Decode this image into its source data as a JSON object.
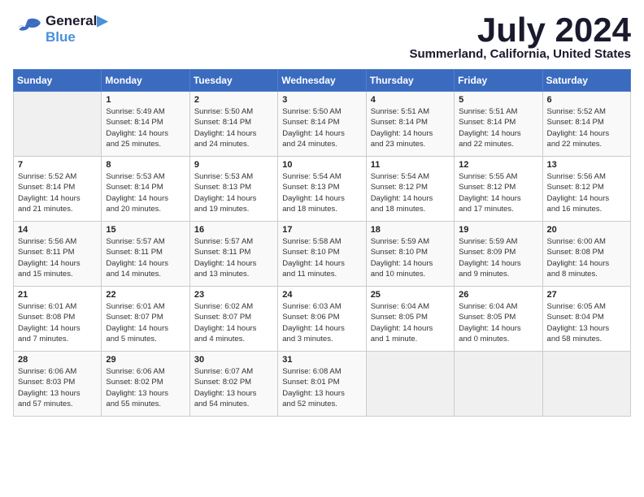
{
  "header": {
    "logo_line1": "General",
    "logo_line2": "Blue",
    "month": "July 2024",
    "location": "Summerland, California, United States"
  },
  "days_of_week": [
    "Sunday",
    "Monday",
    "Tuesday",
    "Wednesday",
    "Thursday",
    "Friday",
    "Saturday"
  ],
  "weeks": [
    [
      {
        "day": "",
        "info": ""
      },
      {
        "day": "1",
        "info": "Sunrise: 5:49 AM\nSunset: 8:14 PM\nDaylight: 14 hours\nand 25 minutes."
      },
      {
        "day": "2",
        "info": "Sunrise: 5:50 AM\nSunset: 8:14 PM\nDaylight: 14 hours\nand 24 minutes."
      },
      {
        "day": "3",
        "info": "Sunrise: 5:50 AM\nSunset: 8:14 PM\nDaylight: 14 hours\nand 24 minutes."
      },
      {
        "day": "4",
        "info": "Sunrise: 5:51 AM\nSunset: 8:14 PM\nDaylight: 14 hours\nand 23 minutes."
      },
      {
        "day": "5",
        "info": "Sunrise: 5:51 AM\nSunset: 8:14 PM\nDaylight: 14 hours\nand 22 minutes."
      },
      {
        "day": "6",
        "info": "Sunrise: 5:52 AM\nSunset: 8:14 PM\nDaylight: 14 hours\nand 22 minutes."
      }
    ],
    [
      {
        "day": "7",
        "info": "Sunrise: 5:52 AM\nSunset: 8:14 PM\nDaylight: 14 hours\nand 21 minutes."
      },
      {
        "day": "8",
        "info": "Sunrise: 5:53 AM\nSunset: 8:14 PM\nDaylight: 14 hours\nand 20 minutes."
      },
      {
        "day": "9",
        "info": "Sunrise: 5:53 AM\nSunset: 8:13 PM\nDaylight: 14 hours\nand 19 minutes."
      },
      {
        "day": "10",
        "info": "Sunrise: 5:54 AM\nSunset: 8:13 PM\nDaylight: 14 hours\nand 18 minutes."
      },
      {
        "day": "11",
        "info": "Sunrise: 5:54 AM\nSunset: 8:12 PM\nDaylight: 14 hours\nand 18 minutes."
      },
      {
        "day": "12",
        "info": "Sunrise: 5:55 AM\nSunset: 8:12 PM\nDaylight: 14 hours\nand 17 minutes."
      },
      {
        "day": "13",
        "info": "Sunrise: 5:56 AM\nSunset: 8:12 PM\nDaylight: 14 hours\nand 16 minutes."
      }
    ],
    [
      {
        "day": "14",
        "info": "Sunrise: 5:56 AM\nSunset: 8:11 PM\nDaylight: 14 hours\nand 15 minutes."
      },
      {
        "day": "15",
        "info": "Sunrise: 5:57 AM\nSunset: 8:11 PM\nDaylight: 14 hours\nand 14 minutes."
      },
      {
        "day": "16",
        "info": "Sunrise: 5:57 AM\nSunset: 8:11 PM\nDaylight: 14 hours\nand 13 minutes."
      },
      {
        "day": "17",
        "info": "Sunrise: 5:58 AM\nSunset: 8:10 PM\nDaylight: 14 hours\nand 11 minutes."
      },
      {
        "day": "18",
        "info": "Sunrise: 5:59 AM\nSunset: 8:10 PM\nDaylight: 14 hours\nand 10 minutes."
      },
      {
        "day": "19",
        "info": "Sunrise: 5:59 AM\nSunset: 8:09 PM\nDaylight: 14 hours\nand 9 minutes."
      },
      {
        "day": "20",
        "info": "Sunrise: 6:00 AM\nSunset: 8:08 PM\nDaylight: 14 hours\nand 8 minutes."
      }
    ],
    [
      {
        "day": "21",
        "info": "Sunrise: 6:01 AM\nSunset: 8:08 PM\nDaylight: 14 hours\nand 7 minutes."
      },
      {
        "day": "22",
        "info": "Sunrise: 6:01 AM\nSunset: 8:07 PM\nDaylight: 14 hours\nand 5 minutes."
      },
      {
        "day": "23",
        "info": "Sunrise: 6:02 AM\nSunset: 8:07 PM\nDaylight: 14 hours\nand 4 minutes."
      },
      {
        "day": "24",
        "info": "Sunrise: 6:03 AM\nSunset: 8:06 PM\nDaylight: 14 hours\nand 3 minutes."
      },
      {
        "day": "25",
        "info": "Sunrise: 6:04 AM\nSunset: 8:05 PM\nDaylight: 14 hours\nand 1 minute."
      },
      {
        "day": "26",
        "info": "Sunrise: 6:04 AM\nSunset: 8:05 PM\nDaylight: 14 hours\nand 0 minutes."
      },
      {
        "day": "27",
        "info": "Sunrise: 6:05 AM\nSunset: 8:04 PM\nDaylight: 13 hours\nand 58 minutes."
      }
    ],
    [
      {
        "day": "28",
        "info": "Sunrise: 6:06 AM\nSunset: 8:03 PM\nDaylight: 13 hours\nand 57 minutes."
      },
      {
        "day": "29",
        "info": "Sunrise: 6:06 AM\nSunset: 8:02 PM\nDaylight: 13 hours\nand 55 minutes."
      },
      {
        "day": "30",
        "info": "Sunrise: 6:07 AM\nSunset: 8:02 PM\nDaylight: 13 hours\nand 54 minutes."
      },
      {
        "day": "31",
        "info": "Sunrise: 6:08 AM\nSunset: 8:01 PM\nDaylight: 13 hours\nand 52 minutes."
      },
      {
        "day": "",
        "info": ""
      },
      {
        "day": "",
        "info": ""
      },
      {
        "day": "",
        "info": ""
      }
    ]
  ]
}
